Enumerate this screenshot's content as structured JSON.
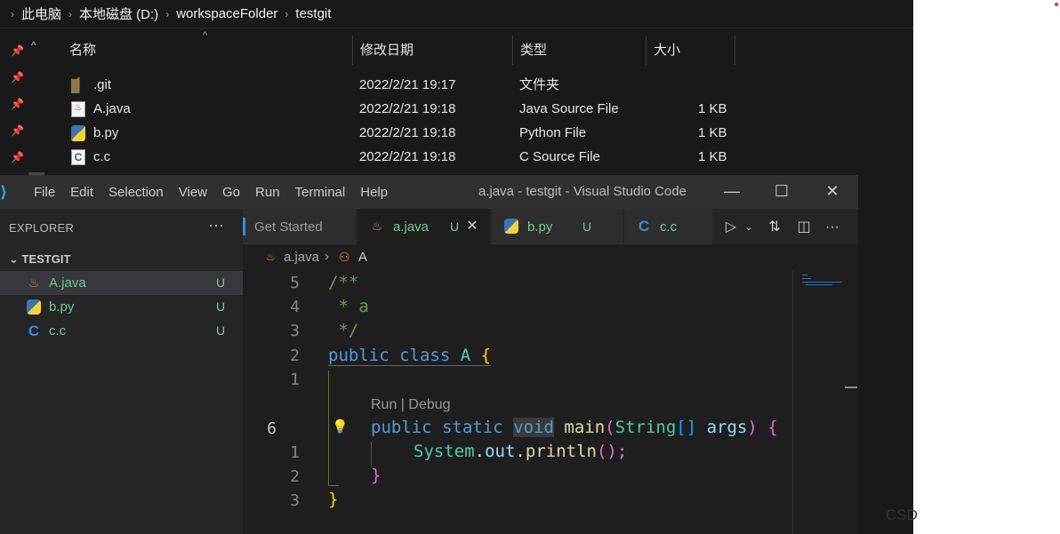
{
  "explorer": {
    "breadcrumb": [
      "此电脑",
      "本地磁盘 (D:)",
      "workspaceFolder",
      "testgit"
    ],
    "columns": {
      "name": "名称",
      "modified": "修改日期",
      "type": "类型",
      "size": "大小"
    },
    "files": [
      {
        "name": ".git",
        "modified": "2022/2/21 19:17",
        "type": "文件夹",
        "size": "",
        "icon": "folder-icon"
      },
      {
        "name": "A.java",
        "modified": "2022/2/21 19:18",
        "type": "Java Source File",
        "size": "1 KB",
        "icon": "java-file-icon"
      },
      {
        "name": "b.py",
        "modified": "2022/2/21 19:18",
        "type": "Python File",
        "size": "1 KB",
        "icon": "python-file-icon"
      },
      {
        "name": "c.c",
        "modified": "2022/2/21 19:18",
        "type": "C Source File",
        "size": "1 KB",
        "icon": "c-file-icon"
      }
    ]
  },
  "vscode": {
    "menu": [
      "File",
      "Edit",
      "Selection",
      "View",
      "Go",
      "Run",
      "Terminal",
      "Help"
    ],
    "window_title": "a.java - testgit - Visual Studio Code",
    "sidebar": {
      "title": "EXPLORER",
      "more": "···",
      "folder": "TESTGIT",
      "items": [
        {
          "label": "A.java",
          "status": "U"
        },
        {
          "label": "b.py",
          "status": "U"
        },
        {
          "label": "c.c",
          "status": "U"
        }
      ]
    },
    "tabs": [
      {
        "label": "Get Started",
        "status": ""
      },
      {
        "label": "a.java",
        "status": "U"
      },
      {
        "label": "b.py",
        "status": "U"
      },
      {
        "label": "c.c",
        "status": ""
      }
    ],
    "breadcrumbs": {
      "file": "a.java",
      "symbol": "A"
    },
    "editor": {
      "line_numbers": [
        "5",
        "4",
        "3",
        "2",
        "1",
        "6",
        "1",
        "2",
        "3"
      ],
      "code_lens": "Run | Debug",
      "lines": {
        "l1": "/**",
        "l2": " * a",
        "l3": " */",
        "l4_kw1": "public",
        "l4_kw2": "class",
        "l4_name": "A",
        "l4_brace": "{",
        "l6_kw1": "public",
        "l6_kw2": "static",
        "l6_kw3": "void",
        "l6_fn": "main",
        "l6_p1": "(",
        "l6_type": "String",
        "l6_arr": "[]",
        "l6_arg": "args",
        "l6_p2": ")",
        "l6_brace": "{",
        "l7_cls": "System",
        "l7_dot1": ".",
        "l7_field": "out",
        "l7_dot2": ".",
        "l7_fn": "println",
        "l7_end": "();",
        "l8_brace": "}",
        "l9_brace": "}"
      }
    }
  },
  "watermark": "CSD",
  "colors": {
    "accent": "#23a9f2",
    "untracked": "#73c991",
    "comment": "#6a9955",
    "keyword": "#569cd6"
  }
}
